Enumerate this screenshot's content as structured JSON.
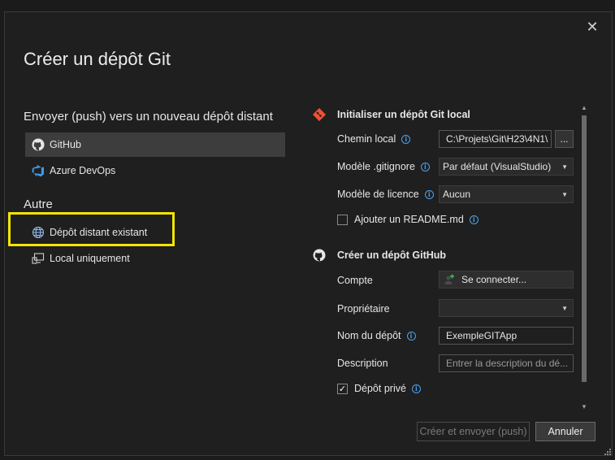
{
  "dialog": {
    "title": "Créer un dépôt Git",
    "close_icon": "close-icon"
  },
  "left": {
    "push_heading": "Envoyer (push) vers un nouveau dépôt distant",
    "push_items": [
      {
        "label": "GitHub",
        "icon": "github-icon",
        "selected": true
      },
      {
        "label": "Azure DevOps",
        "icon": "azure-devops-icon",
        "selected": false
      }
    ],
    "other_heading": "Autre",
    "other_items": [
      {
        "label": "Dépôt distant existant",
        "icon": "globe-icon"
      },
      {
        "label": "Local uniquement",
        "icon": "local-computer-icon"
      }
    ]
  },
  "local_repo": {
    "title": "Initialiser un dépôt Git local",
    "path_label": "Chemin local",
    "path_value": "C:\\Projets\\Git\\H23\\4N1\\",
    "browse_label": "...",
    "gitignore_label": "Modèle .gitignore",
    "gitignore_value": "Par défaut (VisualStudio)",
    "license_label": "Modèle de licence",
    "license_value": "Aucun",
    "readme_label": "Ajouter un README.md",
    "readme_checked": false
  },
  "github_repo": {
    "title": "Créer un dépôt GitHub",
    "account_label": "Compte",
    "connect_label": "Se connecter...",
    "owner_label": "Propriétaire",
    "owner_value": "",
    "name_label": "Nom du dépôt",
    "name_value": "ExempleGITApp",
    "description_label": "Description",
    "description_placeholder": "Entrer la description du dé...",
    "private_label": "Dépôt privé",
    "private_checked": true
  },
  "footer": {
    "create_push_label": "Créer et envoyer (push)",
    "cancel_label": "Annuler"
  },
  "colors": {
    "background": "#1f1f1f",
    "accent_info": "#4aa3f0",
    "highlight": "#f2e500",
    "git_icon": "#f05033"
  }
}
